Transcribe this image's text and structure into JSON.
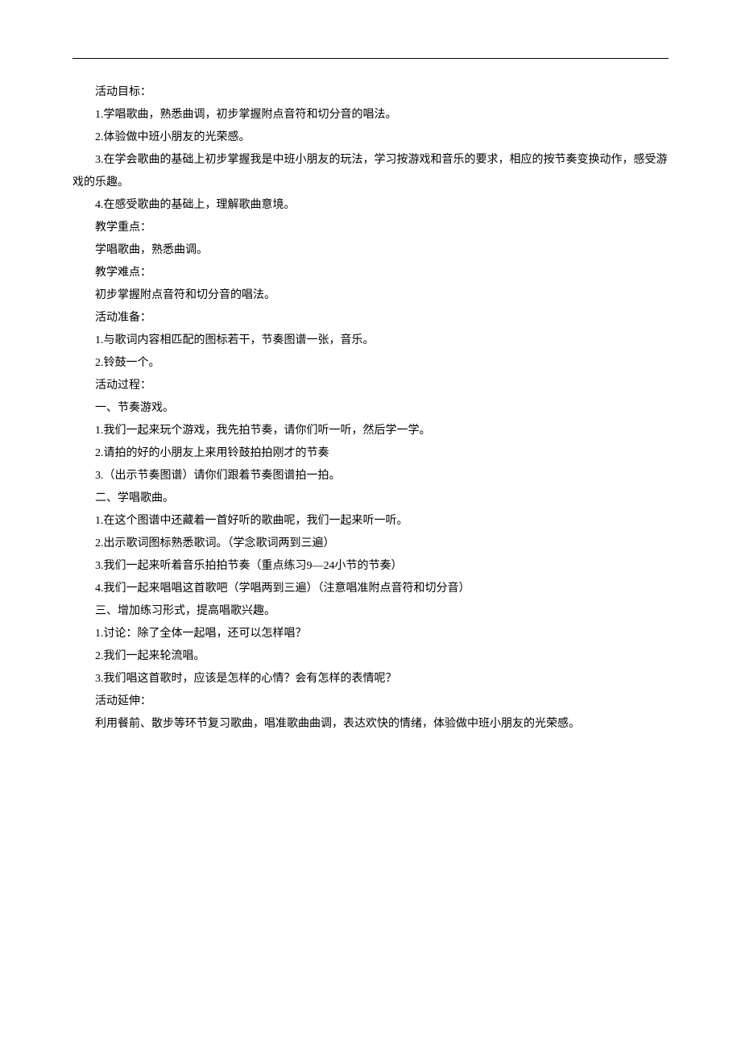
{
  "lines": [
    "活动目标：",
    "1.学唱歌曲，熟悉曲调，初步掌握附点音符和切分音的唱法。",
    "2.体验做中班小朋友的光荣感。",
    "3.在学会歌曲的基础上初步掌握我是中班小朋友的玩法，学习按游戏和音乐的要求，相应的按节奏变换动作，感受游戏的乐趣。",
    "4.在感受歌曲的基础上，理解歌曲意境。",
    "教学重点：",
    "学唱歌曲，熟悉曲调。",
    "教学难点：",
    "初步掌握附点音符和切分音的唱法。",
    "活动准备：",
    "1.与歌词内容相匹配的图标若干，节奏图谱一张，音乐。",
    "2.铃鼓一个。",
    "活动过程：",
    "一、节奏游戏。",
    "1.我们一起来玩个游戏，我先拍节奏，请你们听一听，然后学一学。",
    "2.请拍的好的小朋友上来用铃鼓拍拍刚才的节奏",
    "3.（出示节奏图谱）请你们跟着节奏图谱拍一拍。",
    "二、学唱歌曲。",
    "1.在这个图谱中还藏着一首好听的歌曲呢，我们一起来听一听。",
    "2.出示歌词图标熟悉歌词。（学念歌词两到三遍）",
    "3.我们一起来听着音乐拍拍节奏（重点练习9—24小节的节奏）",
    "4.我们一起来唱唱这首歌吧（学唱两到三遍）（注意唱准附点音符和切分音）",
    "三、增加练习形式，提高唱歌兴趣。",
    "1.讨论：除了全体一起唱，还可以怎样唱？",
    "2.我们一起来轮流唱。",
    "3.我们唱这首歌时，应该是怎样的心情？会有怎样的表情呢？",
    "活动延伸：",
    "利用餐前、散步等环节复习歌曲，唱准歌曲曲调，表达欢快的情绪，体验做中班小朋友的光荣感。"
  ],
  "wrapped_second_line": "游戏的乐趣。"
}
